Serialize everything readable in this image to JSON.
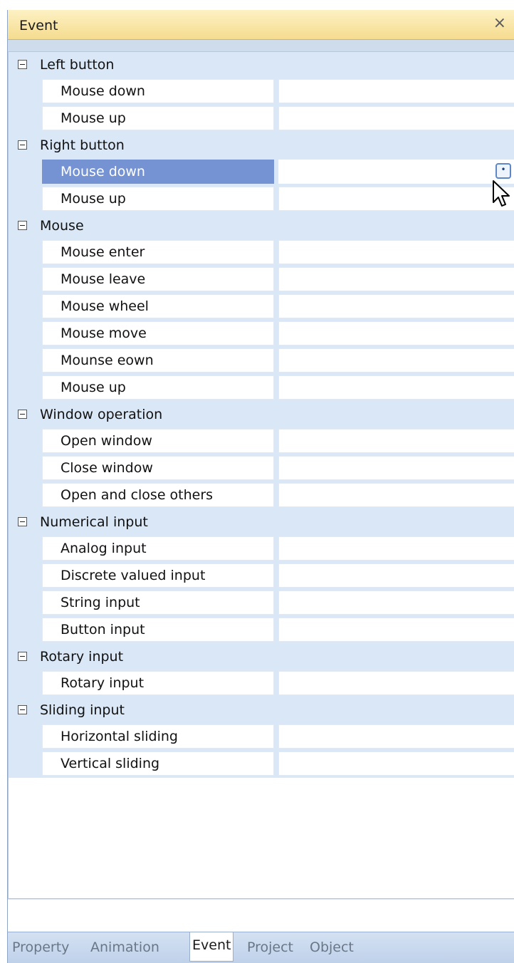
{
  "panel": {
    "title": "Event",
    "close_glyph": "×"
  },
  "categories": [
    {
      "label": "Left button",
      "items": [
        {
          "label": "Mouse down"
        },
        {
          "label": "Mouse up"
        }
      ]
    },
    {
      "label": "Right button",
      "items": [
        {
          "label": "Mouse down",
          "selected": true
        },
        {
          "label": "Mouse up"
        }
      ]
    },
    {
      "label": "Mouse",
      "items": [
        {
          "label": "Mouse enter"
        },
        {
          "label": "Mouse leave"
        },
        {
          "label": "Mouse wheel"
        },
        {
          "label": "Mouse move"
        },
        {
          "label": "Mounse eown"
        },
        {
          "label": "Mouse up"
        }
      ]
    },
    {
      "label": "Window operation",
      "items": [
        {
          "label": "Open window"
        },
        {
          "label": "Close window"
        },
        {
          "label": "Open and close others"
        }
      ]
    },
    {
      "label": "Numerical input",
      "items": [
        {
          "label": "Analog input"
        },
        {
          "label": "Discrete valued input"
        },
        {
          "label": "String input"
        },
        {
          "label": "Button input"
        }
      ]
    },
    {
      "label": "Rotary input",
      "items": [
        {
          "label": "Rotary input"
        }
      ]
    },
    {
      "label": "Sliding input",
      "items": [
        {
          "label": "Horizontal sliding"
        },
        {
          "label": "Vertical sliding"
        }
      ]
    }
  ],
  "tabs": [
    {
      "label": "Property"
    },
    {
      "label": "Animation"
    },
    {
      "label": "Event",
      "active": true
    },
    {
      "label": "Project"
    },
    {
      "label": "Object"
    }
  ],
  "icons": {
    "close": "close-icon",
    "collapse": "collapse-icon",
    "ellipsis": "ellipsis-icon",
    "cursor": "mouse-cursor-icon"
  },
  "colors": {
    "title_bar": "#f5dc8e",
    "category_bg": "#dae7f7",
    "selected": "#7592d2"
  }
}
